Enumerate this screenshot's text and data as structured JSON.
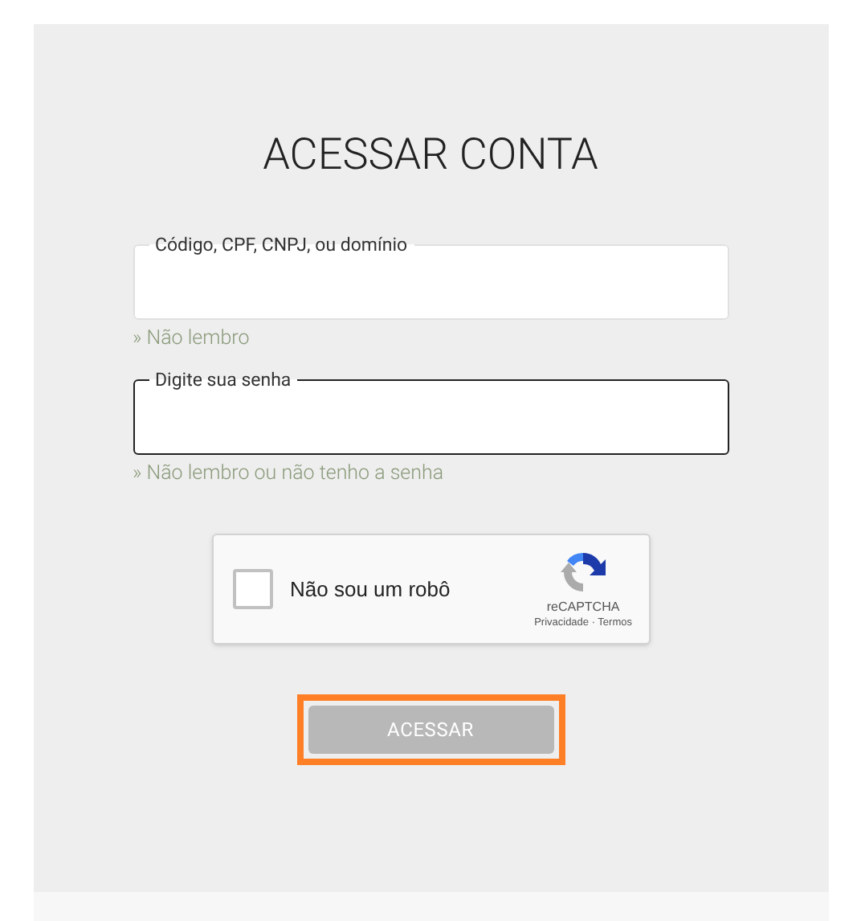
{
  "title": "ACESSAR CONTA",
  "fields": [
    {
      "label": "Código, CPF, CNPJ, ou domínio",
      "focused": false,
      "link": "» Não lembro"
    },
    {
      "label": "Digite sua senha",
      "focused": true,
      "link": "» Não lembro ou não tenho a senha"
    }
  ],
  "captcha": {
    "label": "Não sou um robô",
    "checked": false,
    "brand": "reCAPTCHA",
    "links": "Privacidade · Termos"
  },
  "submit_button": {
    "label": "ACESSAR",
    "disabled": true,
    "highlighted": true
  }
}
